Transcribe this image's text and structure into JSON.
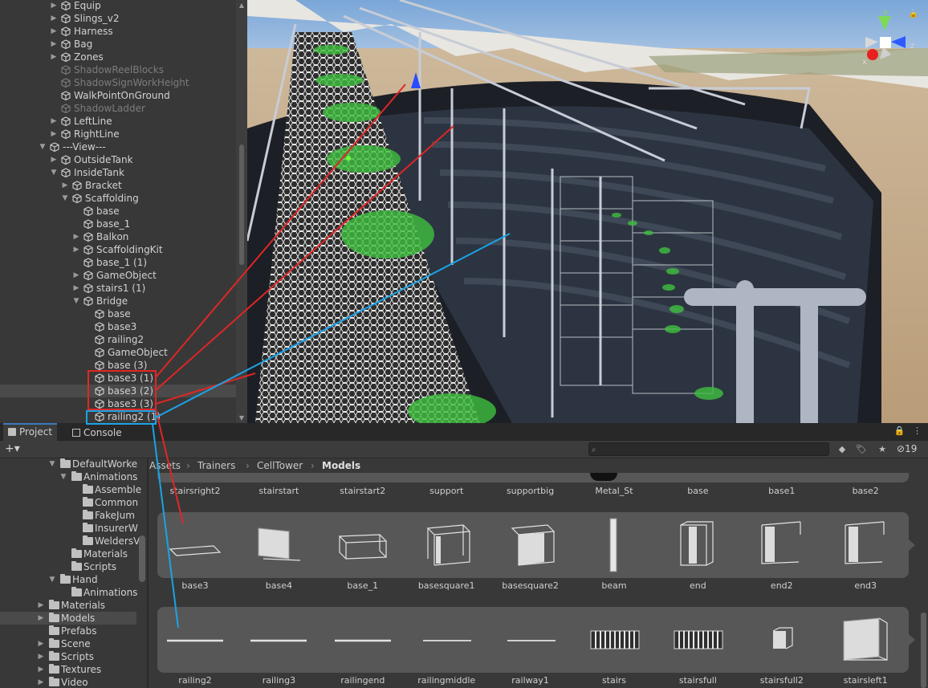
{
  "hierarchy": {
    "items": [
      {
        "label": "Equip",
        "indent": 0,
        "fold": "right",
        "dim": false
      },
      {
        "label": "Slings_v2",
        "indent": 0,
        "fold": "right",
        "dim": false
      },
      {
        "label": "Harness",
        "indent": 0,
        "fold": "right",
        "dim": false
      },
      {
        "label": "Bag",
        "indent": 0,
        "fold": "right",
        "dim": false
      },
      {
        "label": "Zones",
        "indent": 0,
        "fold": "right",
        "dim": false
      },
      {
        "label": "ShadowReelBlocks",
        "indent": 0,
        "fold": "none",
        "dim": true
      },
      {
        "label": "ShadowSignWorkHeight",
        "indent": 0,
        "fold": "none",
        "dim": true
      },
      {
        "label": "WalkPointOnGround",
        "indent": 0,
        "fold": "none",
        "dim": false
      },
      {
        "label": "ShadowLadder",
        "indent": 0,
        "fold": "none",
        "dim": true
      },
      {
        "label": "LeftLine",
        "indent": 0,
        "fold": "right",
        "dim": false
      },
      {
        "label": "RightLine",
        "indent": 0,
        "fold": "right",
        "dim": false
      },
      {
        "label": "---View---",
        "indent": -1,
        "fold": "down",
        "dim": false
      },
      {
        "label": "OutsideTank",
        "indent": 0,
        "fold": "right",
        "dim": false
      },
      {
        "label": "InsideTank",
        "indent": 0,
        "fold": "down",
        "dim": false
      },
      {
        "label": "Bracket",
        "indent": 1,
        "fold": "right",
        "dim": false
      },
      {
        "label": "Scaffolding",
        "indent": 1,
        "fold": "down",
        "dim": false
      },
      {
        "label": "base",
        "indent": 2,
        "fold": "none",
        "dim": false
      },
      {
        "label": "base_1",
        "indent": 2,
        "fold": "none",
        "dim": false
      },
      {
        "label": "Balkon",
        "indent": 2,
        "fold": "right",
        "dim": false
      },
      {
        "label": "ScaffoldingKit",
        "indent": 2,
        "fold": "right",
        "dim": false
      },
      {
        "label": "base_1 (1)",
        "indent": 2,
        "fold": "none",
        "dim": false
      },
      {
        "label": "GameObject",
        "indent": 2,
        "fold": "right",
        "dim": false
      },
      {
        "label": "stairs1 (1)",
        "indent": 2,
        "fold": "right",
        "dim": false
      },
      {
        "label": "Bridge",
        "indent": 2,
        "fold": "down",
        "dim": false
      },
      {
        "label": "base",
        "indent": 3,
        "fold": "none",
        "dim": false
      },
      {
        "label": "base3",
        "indent": 3,
        "fold": "none",
        "dim": false
      },
      {
        "label": "railing2",
        "indent": 3,
        "fold": "none",
        "dim": false
      },
      {
        "label": "GameObject",
        "indent": 3,
        "fold": "none",
        "dim": false
      },
      {
        "label": "base (3)",
        "indent": 3,
        "fold": "none",
        "dim": false
      },
      {
        "label": "base3 (1)",
        "indent": 3,
        "fold": "none",
        "dim": false
      },
      {
        "label": "base3 (2)",
        "indent": 3,
        "fold": "none",
        "dim": false,
        "selected": true
      },
      {
        "label": "base3 (3)",
        "indent": 3,
        "fold": "none",
        "dim": false
      },
      {
        "label": "railing2 (1)",
        "indent": 3,
        "fold": "none",
        "dim": false
      }
    ]
  },
  "scene": {
    "gizmo": {
      "y": "y",
      "z": "z",
      "x": "x"
    }
  },
  "bottom": {
    "tabs": [
      {
        "label": "Project",
        "active": true
      },
      {
        "label": "Console",
        "active": false
      }
    ],
    "search_placeholder": "",
    "hidden_count": "19",
    "plus_label": "+▾",
    "menu_label": "⋮",
    "lock_label": "🔒"
  },
  "project_tree": {
    "items": [
      {
        "label": "DefaultWorke",
        "indent": 2,
        "fold": "down"
      },
      {
        "label": "Animations",
        "indent": 3,
        "fold": "down"
      },
      {
        "label": "Assemble",
        "indent": 4,
        "fold": "none"
      },
      {
        "label": "Common",
        "indent": 4,
        "fold": "none"
      },
      {
        "label": "FakeJum",
        "indent": 4,
        "fold": "none"
      },
      {
        "label": "InsurerW",
        "indent": 4,
        "fold": "none"
      },
      {
        "label": "WeldersV",
        "indent": 4,
        "fold": "none"
      },
      {
        "label": "Materials",
        "indent": 3,
        "fold": "none"
      },
      {
        "label": "Scripts",
        "indent": 3,
        "fold": "none"
      },
      {
        "label": "Hand",
        "indent": 2,
        "fold": "down"
      },
      {
        "label": "Animations",
        "indent": 3,
        "fold": "none"
      },
      {
        "label": "Materials",
        "indent": 1,
        "fold": "right"
      },
      {
        "label": "Models",
        "indent": 1,
        "fold": "right",
        "selected": true
      },
      {
        "label": "Prefabs",
        "indent": 1,
        "fold": "none"
      },
      {
        "label": "Scene",
        "indent": 1,
        "fold": "right"
      },
      {
        "label": "Scripts",
        "indent": 1,
        "fold": "right"
      },
      {
        "label": "Textures",
        "indent": 1,
        "fold": "right"
      },
      {
        "label": "Video",
        "indent": 1,
        "fold": "right"
      }
    ]
  },
  "breadcrumb": [
    "Assets",
    "Trainers",
    "CellTower",
    "Models"
  ],
  "assets": {
    "row0": [
      "stairsright2",
      "stairstart",
      "stairstart2",
      "support",
      "supportbig",
      "Metal_St",
      "base",
      "base1",
      "base2"
    ],
    "row1": [
      "base3",
      "base4",
      "base_1",
      "basesquare1",
      "basesquare2",
      "beam",
      "end",
      "end2",
      "end3"
    ],
    "row2": [
      "railing2",
      "railing3",
      "railingend",
      "railingmiddle",
      "railway1",
      "stairs",
      "stairsfull",
      "stairsfull2",
      "stairsleft1"
    ]
  },
  "colors": {
    "red_annotation": "#e02626",
    "blue_annotation": "#1aa3e6",
    "selection": "#4a4a4a",
    "accent": "#3a79bb"
  }
}
